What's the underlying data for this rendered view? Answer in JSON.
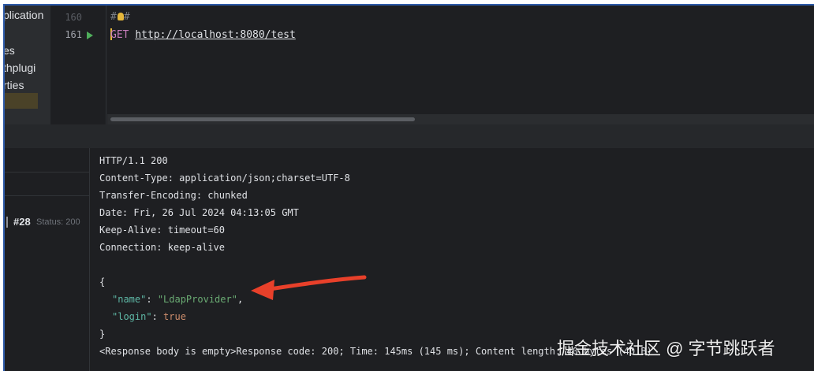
{
  "project_tree": {
    "items": [
      "plication",
      "es",
      "thplugi",
      "rties"
    ]
  },
  "editor": {
    "lines": [
      {
        "number": "160",
        "hash": "#"
      },
      {
        "number": "161",
        "method": "GET",
        "url": "http://localhost:8080/test"
      }
    ]
  },
  "services": {
    "request_id": "#28",
    "status_label": "Status: 200"
  },
  "response": {
    "status_line": "HTTP/1.1 200",
    "headers": [
      "Content-Type: application/json;charset=UTF-8",
      "Transfer-Encoding: chunked",
      "Date: Fri, 26 Jul 2024 04:13:05 GMT",
      "Keep-Alive: timeout=60",
      "Connection: keep-alive"
    ],
    "body": {
      "open_brace": "{",
      "name_key": "\"name\"",
      "name_value": "\"LdapProvider\"",
      "login_key": "\"login\"",
      "login_value": "true",
      "close_brace": "}"
    },
    "footer": "<Response body is empty>Response code: 200; Time: 145ms (145 ms); Content length: 40 bytes (40 B)"
  },
  "watermark": "掘金技术社区 @ 字节跳跃者",
  "colors": {
    "background": "#1e1f22",
    "panel": "#2b2d30",
    "accent_border": "#2d5aa8",
    "arrow": "#e8402a",
    "json_key": "#5eb8a6",
    "json_string": "#6aab73",
    "json_bool": "#cf8e6d",
    "method": "#c77dbb",
    "run_icon": "#4fae5b"
  }
}
